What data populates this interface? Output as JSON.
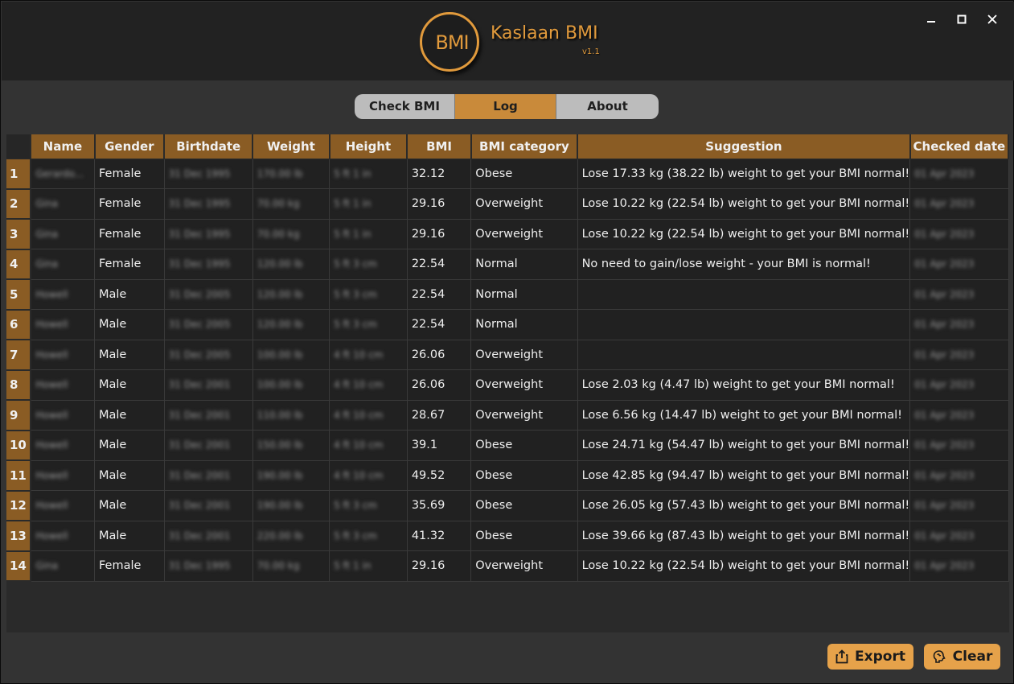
{
  "app": {
    "logo_text": "BMI",
    "title": "Kaslaan BMI",
    "version": "v1.1"
  },
  "window_controls": {
    "minimize_icon": "minimize-icon",
    "maximize_icon": "maximize-icon",
    "close_icon": "close-icon"
  },
  "tabs": [
    {
      "label": "Check BMI",
      "active": false
    },
    {
      "label": "Log",
      "active": true
    },
    {
      "label": "About",
      "active": false
    }
  ],
  "table": {
    "columns": [
      "Name",
      "Gender",
      "Birthdate",
      "Weight",
      "Height",
      "BMI",
      "BMI category",
      "Suggestion",
      "Checked date"
    ],
    "rows": [
      {
        "num": "1",
        "name": "Gerardo...",
        "gender": "Female",
        "birthdate": "31 Dec 1995",
        "weight": "170.00 lb",
        "height": "5 ft 1 in",
        "bmi": "32.12",
        "category": "Obese",
        "suggestion": "Lose 17.33 kg (38.22 lb) weight to get your BMI normal!",
        "checked": "01 Apr 2023"
      },
      {
        "num": "2",
        "name": "Gina",
        "gender": "Female",
        "birthdate": "31 Dec 1995",
        "weight": "70.00 kg",
        "height": "5 ft 1 in",
        "bmi": "29.16",
        "category": "Overweight",
        "suggestion": "Lose 10.22 kg (22.54 lb) weight to get your BMI normal!",
        "checked": "01 Apr 2023"
      },
      {
        "num": "3",
        "name": "Gina",
        "gender": "Female",
        "birthdate": "31 Dec 1995",
        "weight": "70.00 kg",
        "height": "5 ft 1 in",
        "bmi": "29.16",
        "category": "Overweight",
        "suggestion": "Lose 10.22 kg (22.54 lb) weight to get your BMI normal!",
        "checked": "01 Apr 2023"
      },
      {
        "num": "4",
        "name": "Gina",
        "gender": "Female",
        "birthdate": "31 Dec 1995",
        "weight": "120.00 lb",
        "height": "5 ft 3 cm",
        "bmi": "22.54",
        "category": "Normal",
        "suggestion": "No need to gain/lose weight - your BMI is normal!",
        "checked": "01 Apr 2023"
      },
      {
        "num": "5",
        "name": "Howell",
        "gender": "Male",
        "birthdate": "31 Dec 2005",
        "weight": "120.00 lb",
        "height": "5 ft 3 cm",
        "bmi": "22.54",
        "category": "Normal",
        "suggestion": "",
        "checked": "01 Apr 2023"
      },
      {
        "num": "6",
        "name": "Howell",
        "gender": "Male",
        "birthdate": "31 Dec 2005",
        "weight": "120.00 lb",
        "height": "5 ft 3 cm",
        "bmi": "22.54",
        "category": "Normal",
        "suggestion": "",
        "checked": "01 Apr 2023"
      },
      {
        "num": "7",
        "name": "Howell",
        "gender": "Male",
        "birthdate": "31 Dec 2005",
        "weight": "100.00 lb",
        "height": "4 ft 10 cm",
        "bmi": "26.06",
        "category": "Overweight",
        "suggestion": "",
        "checked": "01 Apr 2023"
      },
      {
        "num": "8",
        "name": "Howell",
        "gender": "Male",
        "birthdate": "31 Dec 2001",
        "weight": "100.00 lb",
        "height": "4 ft 10 cm",
        "bmi": "26.06",
        "category": "Overweight",
        "suggestion": "Lose 2.03 kg (4.47 lb) weight to get your BMI normal!",
        "checked": "01 Apr 2023"
      },
      {
        "num": "9",
        "name": "Howell",
        "gender": "Male",
        "birthdate": "31 Dec 2001",
        "weight": "110.00 lb",
        "height": "4 ft 10 cm",
        "bmi": "28.67",
        "category": "Overweight",
        "suggestion": "Lose 6.56 kg (14.47 lb) weight to get your BMI normal!",
        "checked": "01 Apr 2023"
      },
      {
        "num": "10",
        "name": "Howell",
        "gender": "Male",
        "birthdate": "31 Dec 2001",
        "weight": "150.00 lb",
        "height": "4 ft 10 cm",
        "bmi": "39.1",
        "category": "Obese",
        "suggestion": "Lose 24.71 kg (54.47 lb) weight to get your BMI normal!",
        "checked": "01 Apr 2023"
      },
      {
        "num": "11",
        "name": "Howell",
        "gender": "Male",
        "birthdate": "31 Dec 2001",
        "weight": "190.00 lb",
        "height": "4 ft 10 cm",
        "bmi": "49.52",
        "category": "Obese",
        "suggestion": "Lose 42.85 kg (94.47 lb) weight to get your BMI normal!",
        "checked": "01 Apr 2023"
      },
      {
        "num": "12",
        "name": "Howell",
        "gender": "Male",
        "birthdate": "31 Dec 2001",
        "weight": "190.00 lb",
        "height": "5 ft 3 cm",
        "bmi": "35.69",
        "category": "Obese",
        "suggestion": "Lose 26.05 kg (57.43 lb) weight to get your BMI normal!",
        "checked": "01 Apr 2023"
      },
      {
        "num": "13",
        "name": "Howell",
        "gender": "Male",
        "birthdate": "31 Dec 2001",
        "weight": "220.00 lb",
        "height": "5 ft 3 cm",
        "bmi": "41.32",
        "category": "Obese",
        "suggestion": "Lose 39.66 kg (87.43 lb) weight to get your BMI normal!",
        "checked": "01 Apr 2023"
      },
      {
        "num": "14",
        "name": "Gina",
        "gender": "Female",
        "birthdate": "31 Dec 1995",
        "weight": "70.00 kg",
        "height": "5 ft 1 in",
        "bmi": "29.16",
        "category": "Overweight",
        "suggestion": "Lose 10.22 kg (22.54 lb) weight to get your BMI normal!",
        "checked": "01 Apr 2023"
      }
    ]
  },
  "buttons": {
    "export_label": "Export",
    "export_icon": "share-icon",
    "clear_label": "Clear",
    "clear_icon": "brain-icon"
  },
  "colors": {
    "accent": "#e19a3c",
    "header_cell": "#8a5c24",
    "button": "#e6a24a",
    "active_tab": "#c98a3a",
    "tab": "#bcbcbc"
  }
}
